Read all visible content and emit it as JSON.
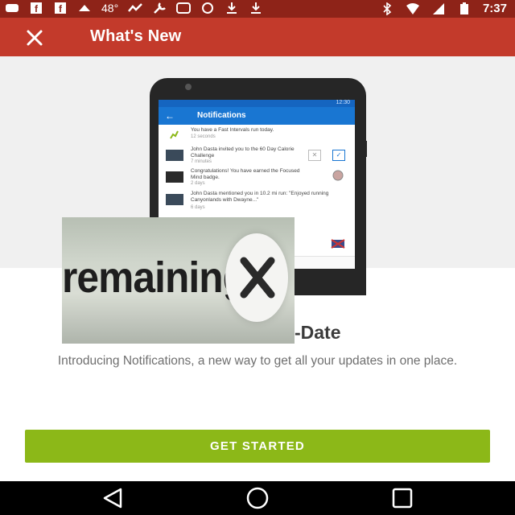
{
  "status_bar": {
    "temperature": "48°",
    "time": "7:37"
  },
  "app_bar": {
    "title": "What's New",
    "close_icon": "close-icon"
  },
  "phone_preview": {
    "time": "12:30",
    "title": "Notifications",
    "notifications": [
      {
        "text": "You have a Fast Intervals run today.",
        "time": "12 seconds"
      },
      {
        "text": "John Dasta invited you to the 60 Day Calorie Challenge",
        "time": "7 minutes"
      },
      {
        "text": "Congratulations! You have earned the Focused Mind badge.",
        "time": "2 days"
      },
      {
        "text": "John Dasta mentioned you in 10.2 mi run: \"Enjoyed running Canyonlands with Dwayne...\"",
        "time": "6 days"
      }
    ]
  },
  "overlay": {
    "word": "remaining"
  },
  "content": {
    "headline": "-Date",
    "description": "Introducing Notifications, a new way to get all your updates in one place."
  },
  "cta": {
    "label": "GET STARTED",
    "color": "#8cb818"
  },
  "nav_bar": {
    "back_icon": "back-triangle-icon",
    "home_icon": "home-circle-icon",
    "recents_icon": "recents-square-icon"
  },
  "colors": {
    "status_bar": "#8e2318",
    "app_bar": "#c33a2b",
    "hero_bg": "#f0f0f0"
  }
}
